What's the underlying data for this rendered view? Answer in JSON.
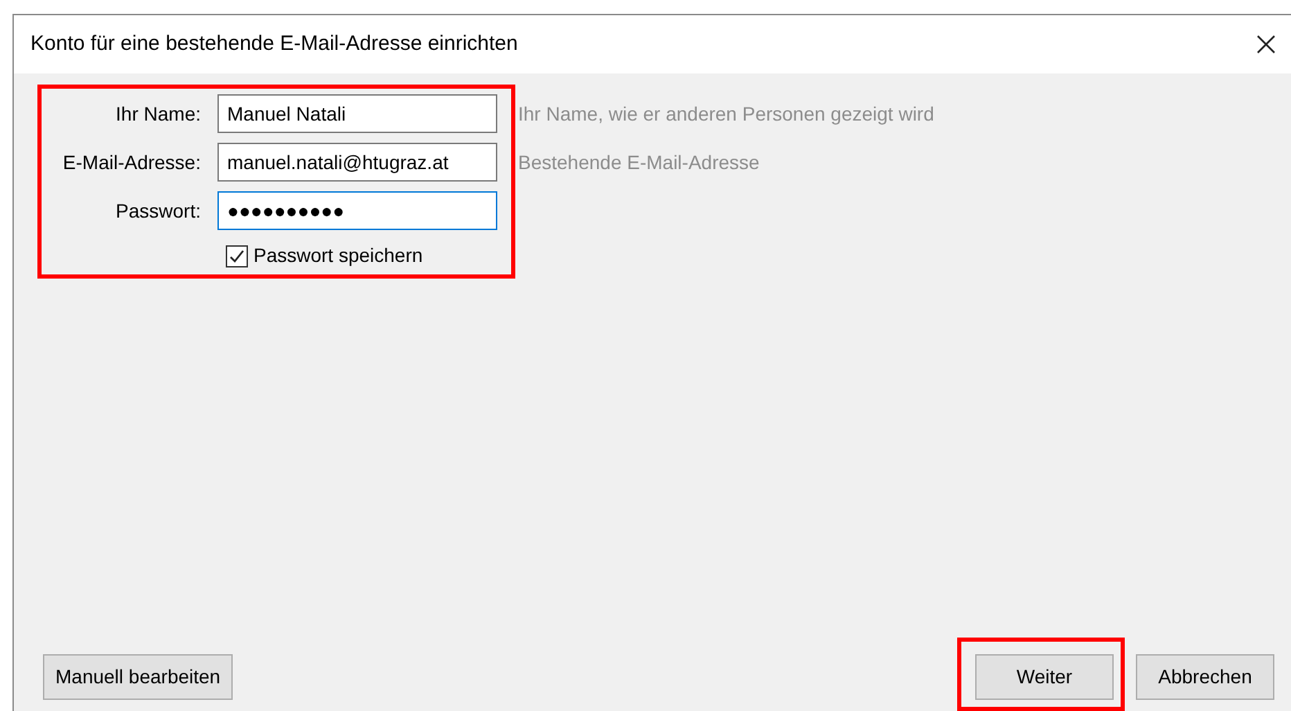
{
  "window": {
    "title": "Konto für eine bestehende E-Mail-Adresse einrichten"
  },
  "fields": [
    {
      "label": "Ihr Name:",
      "value": "Manuel Natali",
      "hint": "Ihr Name, wie er anderen Personen gezeigt wird",
      "focused": false
    },
    {
      "label": "E-Mail-Adresse:",
      "value": "manuel.natali@htugraz.at",
      "hint": "Bestehende E-Mail-Adresse",
      "focused": false
    },
    {
      "label": "Passwort:",
      "value": "●●●●●●●●●●",
      "focused": true
    }
  ],
  "remember_password": {
    "label": "Passwort speichern",
    "checked": true
  },
  "buttons": [
    {
      "label": "Manuell bearbeiten",
      "highlighted": false
    },
    {
      "label": "Weiter",
      "highlighted": true
    },
    {
      "label": "Abbrechen",
      "highlighted": false
    }
  ]
}
